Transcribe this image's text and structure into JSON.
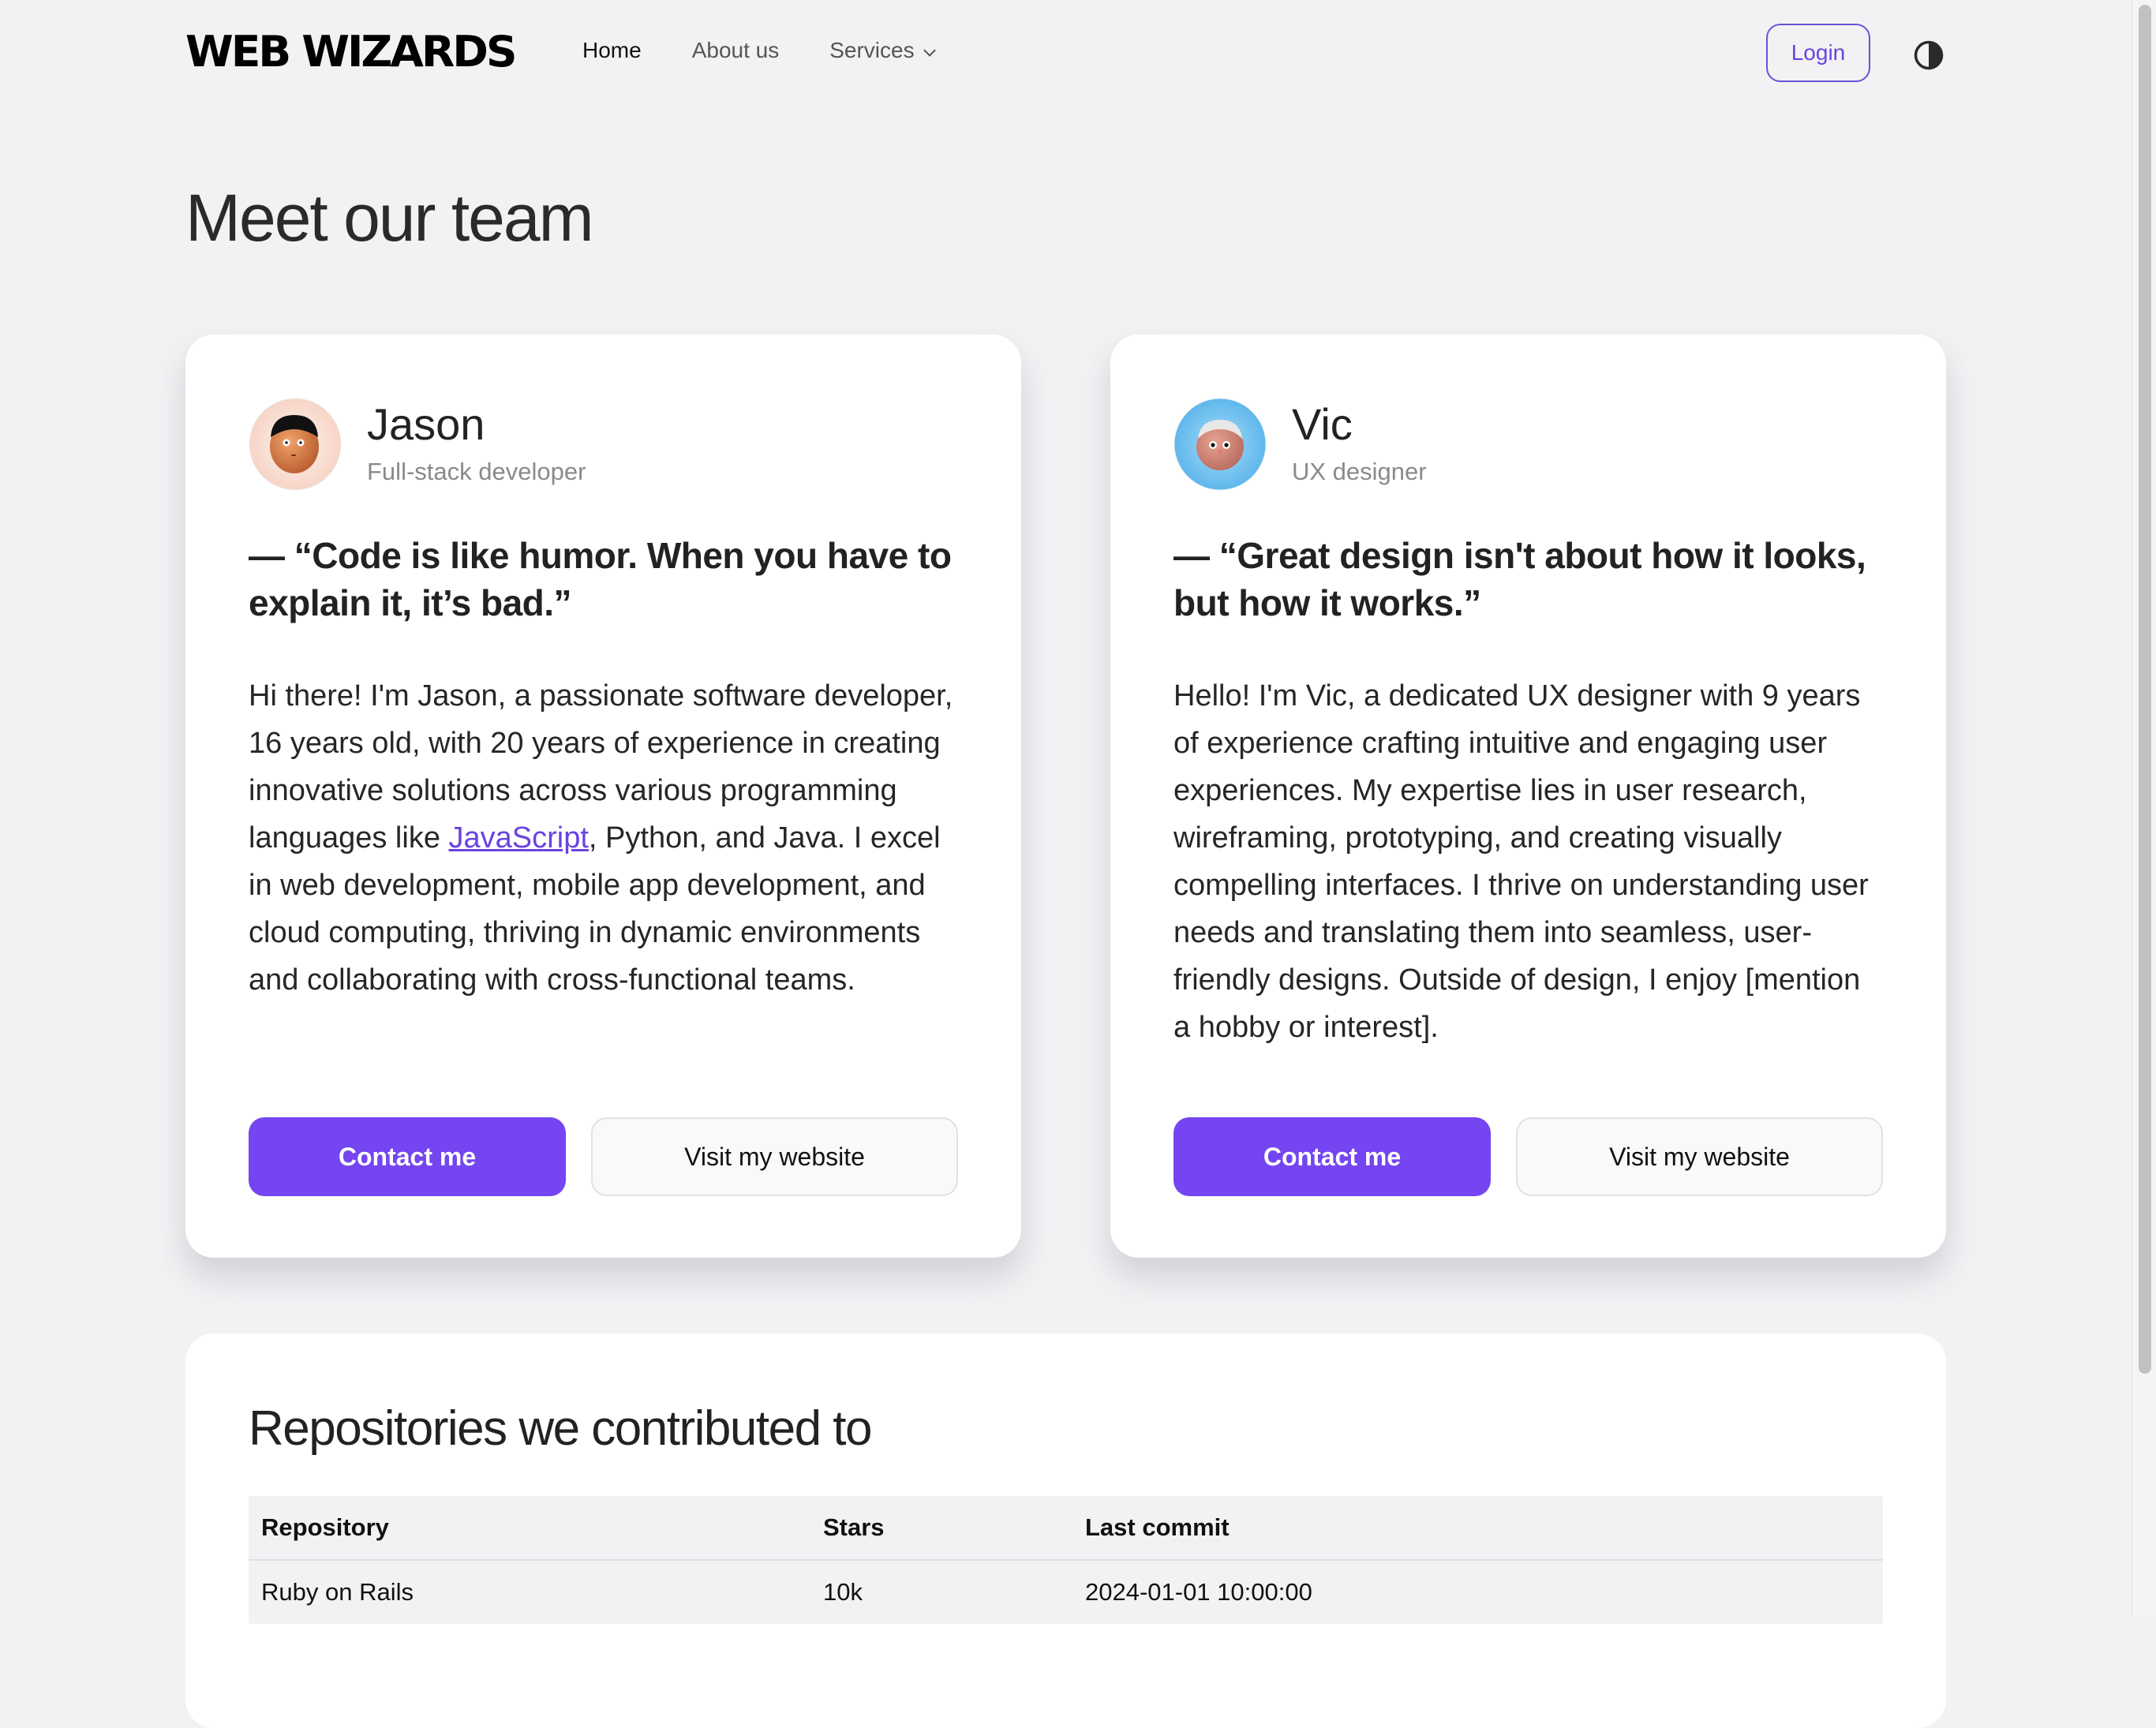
{
  "header": {
    "logo": "WEB WIZARDS",
    "nav": [
      {
        "label": "Home",
        "active": true
      },
      {
        "label": "About us",
        "active": false
      },
      {
        "label": "Services",
        "active": false,
        "has_dropdown": true
      }
    ],
    "login_label": "Login",
    "theme_toggle_icon": "contrast-icon"
  },
  "page": {
    "title": "Meet our team"
  },
  "team": [
    {
      "name": "Jason",
      "role": "Full-stack developer",
      "avatar_bg": "#fbe0d6",
      "quote": "— “Code is like humor. When you have to explain it, it’s bad.”",
      "bio_before_link": "Hi there! I'm Jason, a passionate software developer, 16 years old, with 20 years of experience in creating innovative solutions across various programming languages like ",
      "bio_link": "JavaScript",
      "bio_after_link": ", Python, and Java. I excel in web development, mobile app development, and cloud computing, thriving in dynamic environments and collaborating with cross-functional teams.",
      "primary_action": "Contact me",
      "secondary_action": "Visit my website"
    },
    {
      "name": "Vic",
      "role": "UX designer",
      "avatar_bg": "#7cc8f2",
      "quote": "— “Great design isn't about how it looks, but how it works.”",
      "bio_before_link": "Hello! I'm Vic, a dedicated UX designer with 9 years of experience crafting intuitive and engaging user experiences. My expertise lies in user research, wireframing, prototyping, and creating visually compelling interfaces. I thrive on understanding user needs and translating them into seamless, user-friendly designs. Outside of design, I enjoy [mention a hobby or interest].",
      "bio_link": "",
      "bio_after_link": "",
      "primary_action": "Contact me",
      "secondary_action": "Visit my website"
    }
  ],
  "repositories": {
    "title": "Repositories we contributed to",
    "columns": [
      "Repository",
      "Stars",
      "Last commit"
    ],
    "rows": [
      [
        "Ruby on Rails",
        "10k",
        "2024-01-01 10:00:00"
      ]
    ]
  },
  "colors": {
    "accent": "#7445f0",
    "background": "#f2f2f4",
    "card": "#ffffff"
  }
}
